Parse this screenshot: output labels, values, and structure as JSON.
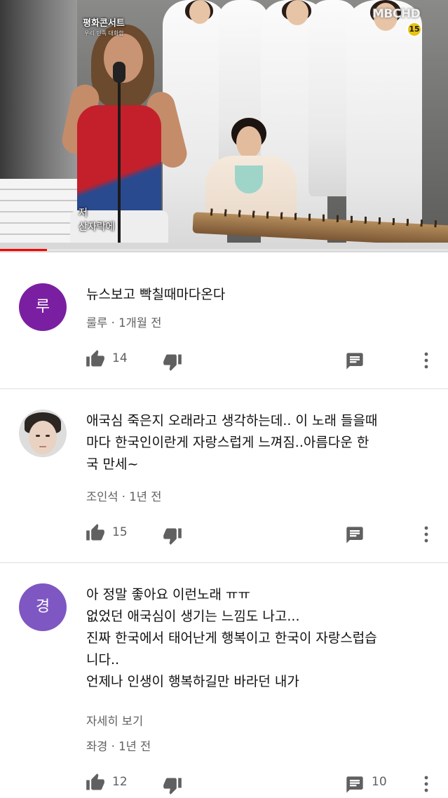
{
  "video": {
    "show_title": "평화콘서트",
    "show_subtitle": "우리 민족 대화합",
    "broadcaster": "MBCHD",
    "age_rating": "15",
    "caption_lines": [
      "저",
      "산자락에"
    ],
    "progress": 0.105,
    "progress_color": "#ff0000"
  },
  "comments": [
    {
      "avatar_letter": "루",
      "avatar_color": "#7b1fa2",
      "text_lines": [
        "뉴스보고 빡칠때마다온다"
      ],
      "author": "룰루",
      "time": "1개월 전",
      "likes": "14",
      "reply_count": ""
    },
    {
      "avatar_letter": "",
      "avatar_color": "#e8e0d8",
      "text_lines": [
        "애국심 죽은지 오래라고 생각하는데.. 이 노래 들을때",
        "마다 한국인이란게 자랑스럽게 느껴짐..아름다운 한",
        "국 만세~"
      ],
      "author": "조인석",
      "time": "1년 전",
      "likes": "15",
      "reply_count": ""
    },
    {
      "avatar_letter": "경",
      "avatar_color": "#7e57c2",
      "text_lines": [
        "아 정말 좋아요 이런노래 ㅠㅠ",
        "없었던 애국심이 생기는 느낌도 나고...",
        "진짜 한국에서 태어난게 행복이고 한국이 자랑스럽습",
        "니다..",
        "언제나 인생이 행복하길만 바라던 내가"
      ],
      "read_more": "자세히 보기",
      "author": "좌경",
      "time": "1년 전",
      "likes": "12",
      "reply_count": "10"
    }
  ],
  "meta_separator": "·",
  "icons": {
    "like": "thumb-up-icon",
    "dislike": "thumb-down-icon",
    "reply": "reply-comment-icon",
    "more": "more-vertical-icon"
  }
}
